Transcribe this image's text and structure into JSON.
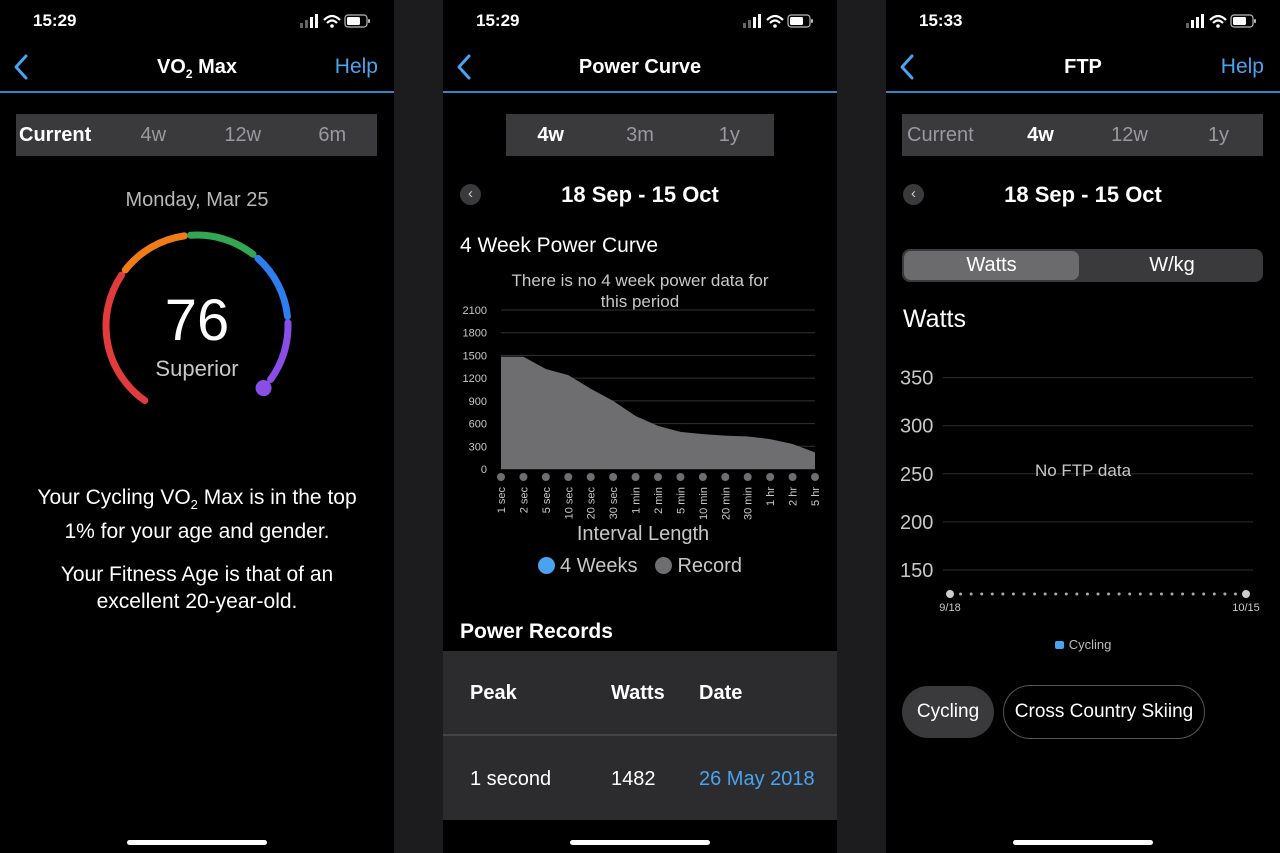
{
  "screen1": {
    "time": "15:29",
    "title": "VO",
    "title_sub": "2",
    "title_rest": " Max",
    "help": "Help",
    "tabs": [
      "Current",
      "4w",
      "12w",
      "6m"
    ],
    "active_tab": "Current",
    "date": "Monday, Mar 25",
    "score": "76",
    "rating": "Superior",
    "gauge_colors": [
      "#e23b3b",
      "#f07c16",
      "#32a852",
      "#2d7ff0",
      "#8a4ee8"
    ],
    "desc1_a": "Your Cycling VO",
    "desc1_sub": "2",
    "desc1_b": " Max is in the top 1% for your age and gender.",
    "desc2": "Your Fitness Age is that of an excellent 20-year-old."
  },
  "screen2": {
    "time": "15:29",
    "title": "Power Curve",
    "tabs": [
      "4w",
      "3m",
      "1y"
    ],
    "active_tab": "4w",
    "range": "18 Sep - 15 Oct",
    "chart_title": "4 Week Power Curve",
    "no_data": "There is no 4 week power data for this period",
    "records_title": "Power Records",
    "table_headers": [
      "Peak",
      "Watts",
      "Date"
    ],
    "table_rows": [
      {
        "peak": "1 second",
        "watts": "1482",
        "date": "26 May 2018"
      }
    ]
  },
  "screen3": {
    "time": "15:33",
    "title": "FTP",
    "help": "Help",
    "tabs": [
      "Current",
      "4w",
      "12w",
      "1y"
    ],
    "active_tab": "4w",
    "range": "18 Sep - 15 Oct",
    "unit_tabs": [
      "Watts",
      "W/kg"
    ],
    "active_unit": "Watts",
    "section_title": "Watts",
    "no_data": "No FTP data",
    "activity_chips": [
      "Cycling",
      "Cross Country Skiing"
    ],
    "active_chip": "Cycling"
  },
  "chart_data": [
    {
      "type": "area",
      "title": "",
      "xlabel": "Interval Length",
      "ylabel": "",
      "x": [
        "1 sec",
        "2 sec",
        "5 sec",
        "10 sec",
        "20 sec",
        "30 sec",
        "1 min",
        "2 min",
        "5 min",
        "10 min",
        "20 min",
        "30 min",
        "1 hr",
        "2 hr",
        "5 hr"
      ],
      "yticks": [
        0,
        300,
        600,
        900,
        1200,
        1500,
        1800,
        2100
      ],
      "ylim": [
        0,
        2100
      ],
      "series": [
        {
          "name": "4 Weeks",
          "color": "#4aa3f0",
          "values": []
        },
        {
          "name": "Record",
          "color": "#6e6e70",
          "values": [
            1482,
            1482,
            1320,
            1240,
            1060,
            900,
            700,
            570,
            490,
            460,
            440,
            430,
            395,
            330,
            220
          ]
        }
      ],
      "grid": true,
      "legend": "bottom"
    },
    {
      "type": "line",
      "title": "",
      "xlabel": "",
      "ylabel": "Watts",
      "x_start": "9/18",
      "x_end": "10/15",
      "yticks": [
        150,
        200,
        250,
        300,
        350
      ],
      "ylim": [
        125,
        360
      ],
      "series": [
        {
          "name": "Cycling",
          "color": "#4aa3f0",
          "values": []
        }
      ],
      "grid": true,
      "legend": "bottom"
    }
  ]
}
